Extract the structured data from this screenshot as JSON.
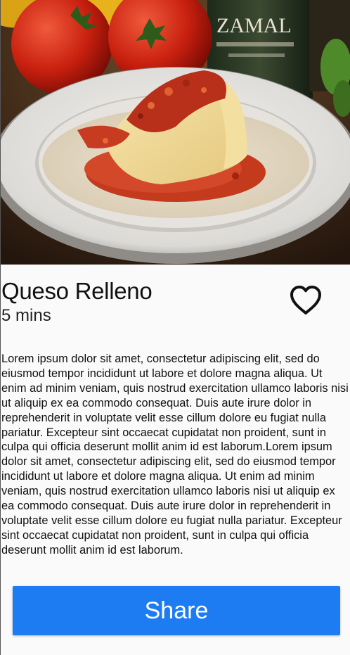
{
  "recipe": {
    "image_alt": "Queso Relleno dish photo",
    "bottle_label": "ZAMAL",
    "title": "Queso Relleno",
    "duration": "5 mins",
    "favorite_icon": "heart-outline-icon",
    "description": "Lorem ipsum dolor sit amet, consectetur adipiscing elit, sed do eiusmod tempor incididunt ut labore et dolore magna aliqua. Ut enim ad minim veniam, quis nostrud exercitation ullamco laboris nisi ut aliquip ex ea commodo consequat. Duis aute irure dolor in reprehenderit in voluptate velit esse cillum dolore eu fugiat nulla pariatur. Excepteur sint occaecat cupidatat non proident, sunt in culpa qui officia deserunt mollit anim id est laborum.Lorem ipsum dolor sit amet, consectetur adipiscing elit, sed do eiusmod tempor incididunt ut labore et dolore magna aliqua. Ut enim ad minim veniam, quis nostrud exercitation ullamco laboris nisi ut aliquip ex ea commodo consequat. Duis aute irure dolor in reprehenderit in voluptate velit esse cillum dolore eu fugiat nulla pariatur. Excepteur sint occaecat cupidatat non proident, sunt in culpa qui officia deserunt mollit anim id est laborum."
  },
  "actions": {
    "share_label": "Share"
  },
  "colors": {
    "accent": "#1e7cf2",
    "background": "#fafafa"
  }
}
